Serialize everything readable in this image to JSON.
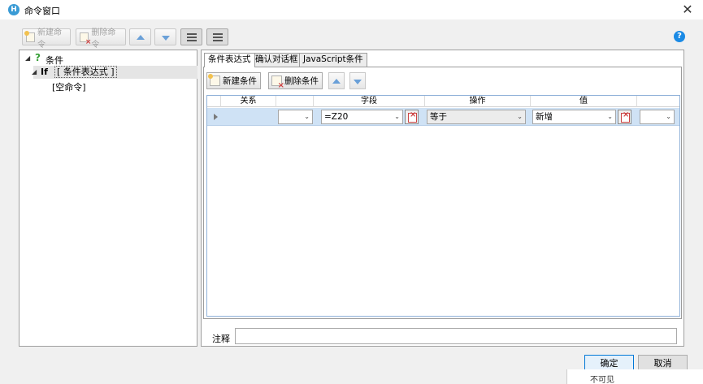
{
  "window": {
    "title": "命令窗口",
    "app_icon_letter": "H",
    "close_glyph": "✕"
  },
  "toolbar": {
    "new_command": "新建命令",
    "delete_command": "删除命令",
    "help_glyph": "?"
  },
  "tree": {
    "root_label": "条件",
    "root_icon": "question-icon",
    "if_keyword": "If",
    "if_label": "[ 条件表达式 ]",
    "empty_command": "[空命令]"
  },
  "tabs": [
    {
      "label": "条件表达式",
      "active": true
    },
    {
      "label": "确认对话框",
      "active": false
    },
    {
      "label": "JavaScript条件",
      "active": false
    }
  ],
  "condition_toolbar": {
    "new_condition": "新建条件",
    "delete_condition": "删除条件"
  },
  "grid": {
    "columns": [
      "关系",
      "字段",
      "操作",
      "值"
    ],
    "rows": [
      {
        "relation": "",
        "field": "=Z20",
        "operator": "等于",
        "value": "新增",
        "extra": ""
      }
    ]
  },
  "note": {
    "label": "注释",
    "value": ""
  },
  "footer": {
    "ok": "确定",
    "cancel": "取消"
  },
  "background": {
    "partial_text": "不可见"
  },
  "colors": {
    "selection_row": "#cfe2f5",
    "accent": "#0078d7",
    "help": "#1a8ae5"
  }
}
